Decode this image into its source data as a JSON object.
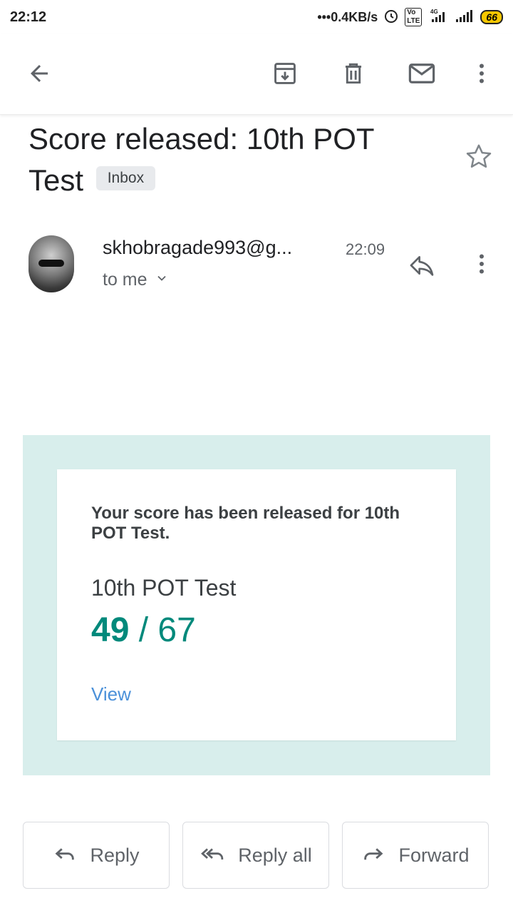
{
  "status_bar": {
    "time": "22:12",
    "network_speed": "0.4KB/s",
    "network_type": "4G",
    "volte_label": "VoLTE",
    "battery": "66"
  },
  "toolbar": {
    "icons": [
      "back-arrow-icon",
      "archive-icon",
      "delete-icon",
      "mark-unread-icon",
      "more-vert-icon"
    ]
  },
  "email": {
    "subject": "Score released: 10th POT Test",
    "label": "Inbox",
    "sender": "skhobragade993@g...",
    "time": "22:09",
    "recipient": "to me"
  },
  "body": {
    "message": "Your score has been released for 10th POT Test.",
    "test_name": "10th POT Test",
    "score": "49",
    "separator": "/",
    "total": "67",
    "view_link": "View"
  },
  "actions": {
    "reply": "Reply",
    "reply_all": "Reply all",
    "forward": "Forward"
  },
  "colors": {
    "accent_teal": "#00897b",
    "card_background": "#d8eeec",
    "link": "#4a90d9"
  }
}
